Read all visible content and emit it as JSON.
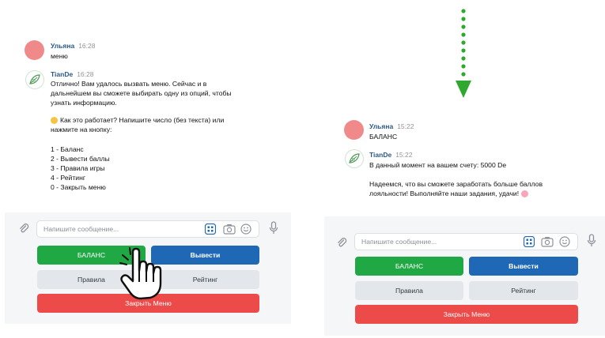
{
  "left": {
    "messages": [
      {
        "name": "Ульяна",
        "time": "16:28",
        "text": "меню"
      },
      {
        "name": "TianDe",
        "time": "16:28",
        "lines": [
          "Отлично! Вам удалось вызвать меню. Сейчас и в",
          "дальнейшем вы сможете выбирать одну из опций, чтобы",
          "узнать информацию.",
          "",
          "Как это работает? Напишите число (без текста) или",
          "нажмите на кнопку:",
          "",
          "1 - Баланс",
          "2 - Вывести баллы",
          "3 - Правила игры",
          "4 - Рейтинг",
          "0 - Закрыть меню"
        ]
      }
    ],
    "placeholder": "Напишите сообщение...",
    "buttons": {
      "balance": "БАЛАНС",
      "withdraw": "Вывести",
      "rules": "Правила",
      "rating": "Рейтинг",
      "close": "Закрыть Меню"
    }
  },
  "right": {
    "messages": [
      {
        "name": "Ульяна",
        "time": "15:22",
        "text": "БАЛАНС"
      },
      {
        "name": "TianDe",
        "time": "15:22",
        "lines": [
          "В данный момент на вашем счету: 5000 De",
          "",
          "Надеемся, что вы сможете заработать больше баллов",
          "лояльности! Выполняйте наши задания, удачи!"
        ]
      }
    ],
    "placeholder": "Напишите сообщение...",
    "buttons": {
      "balance": "БАЛАНС",
      "withdraw": "Вывести",
      "rules": "Правила",
      "rating": "Рейтинг",
      "close": "Закрыть Меню"
    }
  },
  "icons": [
    "paperclip-icon",
    "keyboard-grid-icon",
    "camera-icon",
    "smiley-icon",
    "microphone-icon",
    "pointing-hand-icon",
    "dotted-down-arrow-icon"
  ],
  "colors": {
    "green": "#1fa843",
    "blue": "#1f68b5",
    "gray": "#e3e7ec",
    "red": "#ed4a4a",
    "accent": "#2a5885",
    "arrow": "#2fa82f"
  }
}
